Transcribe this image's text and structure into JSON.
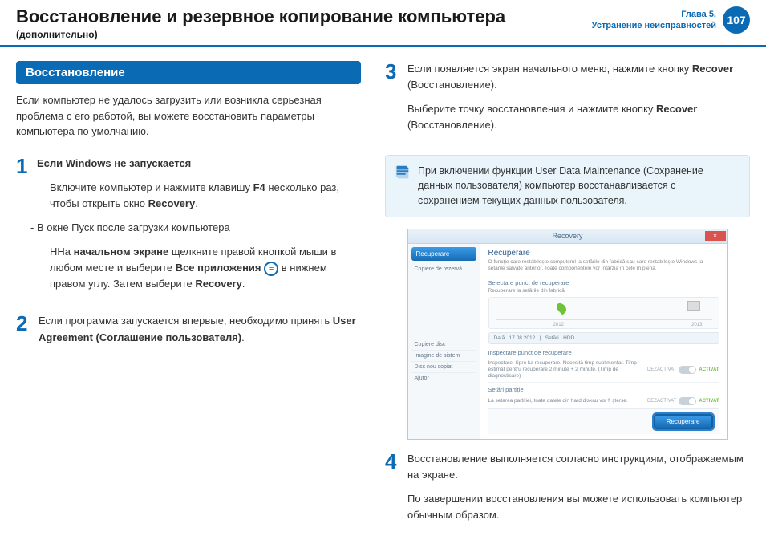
{
  "header": {
    "title": "Восстановление и резервное копирование компьютера",
    "subtitle": "(дополнительно)",
    "chapter_line1": "Глава 5.",
    "chapter_line2": "Устранение неисправностей",
    "page_number": "107"
  },
  "left": {
    "section_title": "Восстановление",
    "intro": "Если компьютер не удалось загрузить или возникла серьезная проблема с его работой, вы можете восстановить параметры компьютера по умолчанию.",
    "step1": {
      "num": "1",
      "h1_prefix": "-  ",
      "h1": "Если Windows не запускается",
      "p1a": "Включите компьютер и нажмите клавишу ",
      "p1b": "F4",
      "p1c": " несколько раз, чтобы открыть окно ",
      "p1d": "Recovery",
      "p1e": ".",
      "h2_prefix": "-  В окне Пуск после загрузки компьютера",
      "p2a": "ННа ",
      "p2b": "начальном экране",
      "p2c": " щелкните правой кнопкой мыши в любом месте и выберите ",
      "p2d": "Все приложения",
      "p2e": " в нижнем правом углу. Затем выберите ",
      "p2f": "Recovery",
      "p2g": "."
    },
    "step2": {
      "num": "2",
      "a": "Если программа запускается впервые, необходимо принять ",
      "b": "User Agreement (Соглашение пользователя)",
      "c": "."
    }
  },
  "right": {
    "step3": {
      "num": "3",
      "a": "Если появляется экран начального меню, нажмите кнопку ",
      "b": "Recover",
      "c": " (Восстановление).",
      "d": "Выберите точку восстановления и нажмите кнопку ",
      "e": "Recover",
      "f": " (Восстановление)."
    },
    "note": "При включении функции User Data Maintenance (Сохранение данных пользователя) компьютер восстанавливается с сохранением текущих данных пользователя.",
    "shot": {
      "title": "Recovery",
      "tab": "Recuperare",
      "side_item": "Copiere de rezervă",
      "nav1": "Copiere disc",
      "nav2": "Imagine de sistem",
      "nav3": "Disc nou copiat",
      "nav4": "Ajutor",
      "h": "Recuperare",
      "sub": "O funcție care restabilește computerul la setările din fabrică sau care restabilește Windows la setările salvate anterior. Toate componentele vor intârzia în cele în plenă.",
      "sect1": "Selectare punct de recuperare",
      "sect1b": "Recuperare la setările din fabrică",
      "year1": "2012",
      "year2": "2013",
      "infobar_a": "Dată",
      "infobar_b": "17.08.2012",
      "infobar_c": "Setări",
      "infobar_d": "HDD",
      "sect2": "Inspectare punct de recuperare",
      "row1": "Inspectare: Spre ka recuperare. Necesită timp suplimentar. Timp estimat pentru recuperare 2 minute + 2 minute. (Timp de diagnosticare)",
      "sect3": "Setări partiție",
      "row2": "La setarea partiției, toate datele din hard diskau vor fi șterse.",
      "toggle_off": "DEZACTIVAT",
      "toggle_on": "ACTIVAT",
      "btn": "Recuperare"
    },
    "step4": {
      "num": "4",
      "a": "Восстановление выполняется согласно инструкциям, отображаемым на экране.",
      "b": "По завершении восстановления вы можете использовать компьютер обычным образом."
    }
  }
}
